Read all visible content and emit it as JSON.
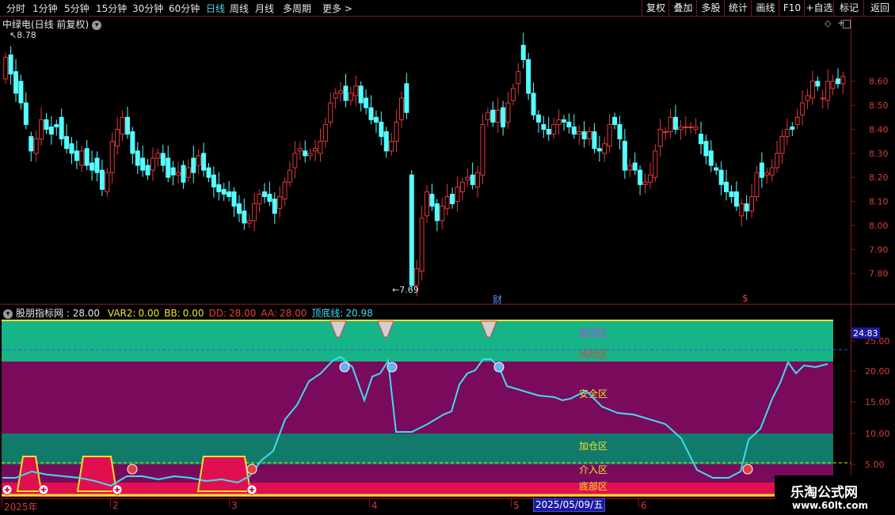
{
  "colors": {
    "up": "#e0393e",
    "down": "#54ffff",
    "bg": "#000000",
    "frame": "#8b1a1a",
    "ind_line": "#3fdcf0"
  },
  "menu": {
    "items": [
      {
        "label": "分时",
        "active": false
      },
      {
        "label": "1分钟",
        "active": false
      },
      {
        "label": "5分钟",
        "active": false
      },
      {
        "label": "15分钟",
        "active": false
      },
      {
        "label": "30分钟",
        "active": false
      },
      {
        "label": "60分钟",
        "active": false
      },
      {
        "label": "日线",
        "active": true
      },
      {
        "label": "周线",
        "active": false
      },
      {
        "label": "月线",
        "active": false
      },
      {
        "label": "多周期",
        "active": false
      },
      {
        "label": "更多 >",
        "active": false
      }
    ],
    "right_buttons": [
      "复权",
      "叠加",
      "多股",
      "统计",
      "画线",
      "F10",
      "+自选",
      "标记",
      "返回"
    ]
  },
  "price_chart": {
    "title": "中绿电(日线 前复权)",
    "high_label": "8.78",
    "low_label": "7.69",
    "event_marker_cai": "财",
    "event_marker_s": "$",
    "y_ticks": [
      "8.60",
      "8.50",
      "8.40",
      "8.30",
      "8.20",
      "8.10",
      "8.00",
      "7.90",
      "7.80"
    ]
  },
  "indicator": {
    "name": "股朋指标网",
    "value": "28.00",
    "fields": [
      {
        "label": "VAR2:",
        "value": "0.00",
        "color": "#f2e22a"
      },
      {
        "label": "BB:",
        "value": "0.00",
        "color": "#f2e22a"
      },
      {
        "label": "DD:",
        "value": "28.00",
        "color": "#e84040"
      },
      {
        "label": "AA:",
        "value": "28.00",
        "color": "#e84040"
      },
      {
        "label": "顶底线:",
        "value": "20.98",
        "color": "#3fdcf0"
      }
    ],
    "current_value": "24.83",
    "y_ticks": [
      "25.00",
      "20.00",
      "15.00",
      "10.00",
      "5.00"
    ],
    "zones": [
      {
        "label": "逃顶区",
        "color": "#c040e0"
      },
      {
        "label": "风险区",
        "color": "#e04040"
      },
      {
        "label": "安全区",
        "color": "#f2e22a"
      },
      {
        "label": "加仓区",
        "color": "#f2e22a"
      },
      {
        "label": "介入区",
        "color": "#f2e22a"
      },
      {
        "label": "底部区",
        "color": "#f2e22a"
      }
    ]
  },
  "x_axis": {
    "labels": [
      "2025年",
      "2",
      "3",
      "4",
      "5",
      "6"
    ],
    "cursor_date": "2025/05/09/五"
  },
  "watermark": {
    "main": "乐淘公式网",
    "sub": "www.60lt.com"
  },
  "chart_data": {
    "type": "candlestick",
    "title": "中绿电(日线 前复权)",
    "ylim": [
      7.72,
      8.8
    ],
    "close": [
      8.7,
      8.63,
      8.55,
      8.51,
      8.42,
      8.31,
      8.36,
      8.44,
      8.4,
      8.38,
      8.41,
      8.36,
      8.32,
      8.3,
      8.27,
      8.31,
      8.25,
      8.23,
      8.22,
      8.15,
      8.22,
      8.35,
      8.4,
      8.45,
      8.38,
      8.3,
      8.25,
      8.23,
      8.21,
      8.28,
      8.3,
      8.25,
      8.2,
      8.21,
      8.22,
      8.18,
      8.24,
      8.22,
      8.29,
      8.23,
      8.2,
      8.16,
      8.14,
      8.13,
      8.12,
      8.08,
      8.05,
      8.01,
      8.02,
      8.09,
      8.13,
      8.12,
      8.1,
      8.05,
      8.12,
      8.18,
      8.23,
      8.3,
      8.32,
      8.29,
      8.3,
      8.32,
      8.35,
      8.42,
      8.51,
      8.55,
      8.56,
      8.52,
      8.55,
      8.58,
      8.51,
      8.49,
      8.44,
      8.43,
      8.37,
      8.31,
      8.35,
      8.43,
      8.53,
      8.47,
      7.75,
      7.82,
      8.03,
      8.14,
      8.08,
      8.02,
      8.08,
      8.12,
      8.09,
      8.16,
      8.18,
      8.2,
      8.17,
      8.22,
      8.42,
      8.47,
      8.43,
      8.48,
      8.41,
      8.51,
      8.57,
      8.64,
      8.69,
      8.55,
      8.46,
      8.43,
      8.4,
      8.38,
      8.42,
      8.44,
      8.43,
      8.41,
      8.38,
      8.39,
      8.36,
      8.39,
      8.32,
      8.31,
      8.34,
      8.42,
      8.42,
      8.36,
      8.23,
      8.25,
      8.23,
      8.17,
      8.18,
      8.21,
      8.31,
      8.4,
      8.39,
      8.45,
      8.4,
      8.41,
      8.41,
      8.41,
      8.41,
      8.34,
      8.29,
      8.25,
      8.23,
      8.17,
      8.14,
      8.12,
      8.08,
      8.09,
      8.06,
      8.12,
      8.22,
      8.2,
      8.22,
      8.24,
      8.3,
      8.37,
      8.4,
      8.4,
      8.45,
      8.51,
      8.54,
      8.6,
      8.58,
      8.53,
      8.6,
      8.6,
      8.59,
      8.62
    ],
    "open": [
      8.61,
      8.71,
      8.64,
      8.6,
      8.51,
      8.37,
      8.3,
      8.36,
      8.44,
      8.41,
      8.42,
      8.45,
      8.37,
      8.34,
      8.31,
      8.25,
      8.32,
      8.26,
      8.28,
      8.23,
      8.14,
      8.22,
      8.33,
      8.38,
      8.45,
      8.39,
      8.31,
      8.28,
      8.25,
      8.23,
      8.28,
      8.3,
      8.28,
      8.24,
      8.21,
      8.25,
      8.2,
      8.28,
      8.25,
      8.3,
      8.24,
      8.21,
      8.17,
      8.15,
      8.14,
      8.14,
      8.09,
      8.06,
      8.01,
      8.02,
      8.09,
      8.14,
      8.13,
      8.11,
      8.07,
      8.11,
      8.18,
      8.24,
      8.31,
      8.31,
      8.29,
      8.31,
      8.3,
      8.35,
      8.43,
      8.53,
      8.55,
      8.58,
      8.52,
      8.54,
      8.58,
      8.53,
      8.49,
      8.45,
      8.43,
      8.39,
      8.31,
      8.35,
      8.44,
      8.59,
      8.21,
      7.75,
      7.81,
      8.04,
      8.13,
      8.09,
      8.02,
      8.07,
      8.13,
      8.1,
      8.14,
      8.19,
      8.21,
      8.16,
      8.21,
      8.44,
      8.48,
      8.43,
      8.49,
      8.43,
      8.52,
      8.59,
      8.75,
      8.69,
      8.55,
      8.46,
      8.42,
      8.4,
      8.38,
      8.42,
      8.44,
      8.43,
      8.41,
      8.38,
      8.39,
      8.36,
      8.39,
      8.32,
      8.3,
      8.33,
      8.45,
      8.42,
      8.35,
      8.23,
      8.26,
      8.23,
      8.17,
      8.18,
      8.2,
      8.33,
      8.39,
      8.39,
      8.45,
      8.4,
      8.41,
      8.41,
      8.4,
      8.38,
      8.35,
      8.31,
      8.24,
      8.23,
      8.18,
      8.14,
      8.14,
      8.04,
      8.09,
      8.06,
      8.12,
      8.26,
      8.21,
      8.21,
      8.24,
      8.3,
      8.37,
      8.41,
      8.42,
      8.46,
      8.52,
      8.53,
      8.6,
      8.53,
      8.52,
      8.57,
      8.61,
      8.59
    ]
  }
}
